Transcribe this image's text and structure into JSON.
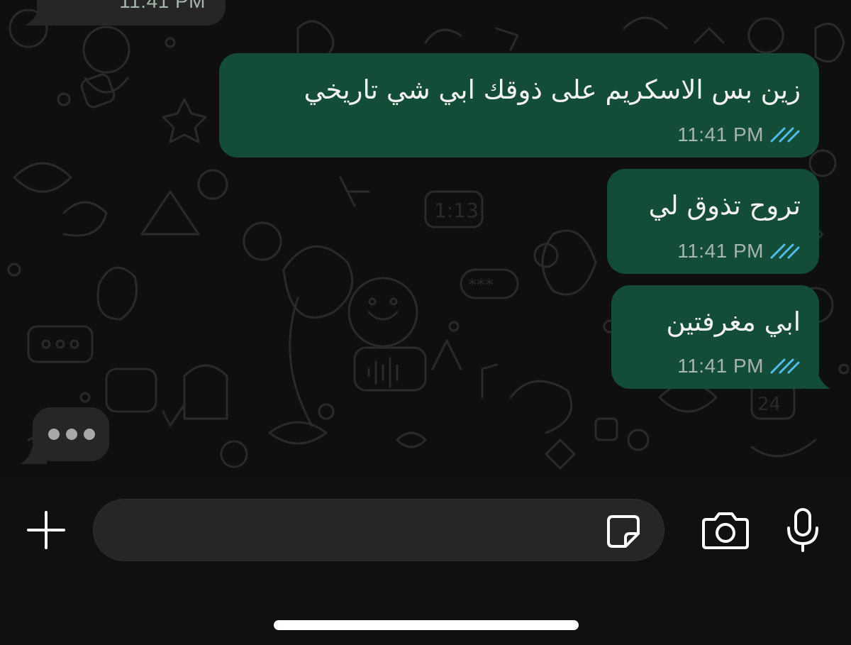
{
  "conversation": {
    "incoming_time": "11:41 PM",
    "messages": [
      {
        "direction": "outgoing",
        "text": "زين بس الاسكريم على ذوقك ابي شي تاريخي",
        "time": "11:41 PM",
        "status": "read"
      },
      {
        "direction": "outgoing",
        "text": "تروح تذوق لي",
        "time": "11:41 PM",
        "status": "read"
      },
      {
        "direction": "outgoing",
        "text": "ابي مغرفتين",
        "time": "11:41 PM",
        "status": "read"
      }
    ],
    "typing_indicator": "typing-dots"
  },
  "composer": {
    "message_value": "",
    "icons": {
      "attach": "plus-icon",
      "sticker": "sticker-icon",
      "camera": "camera-icon",
      "voice": "microphone-icon"
    }
  },
  "colors": {
    "outgoing_bubble": "#144d37",
    "incoming_bubble": "#262626",
    "read_ticks": "#53bdeb",
    "timestamp": "#a6b5ae",
    "background": "#0f0f0f"
  }
}
